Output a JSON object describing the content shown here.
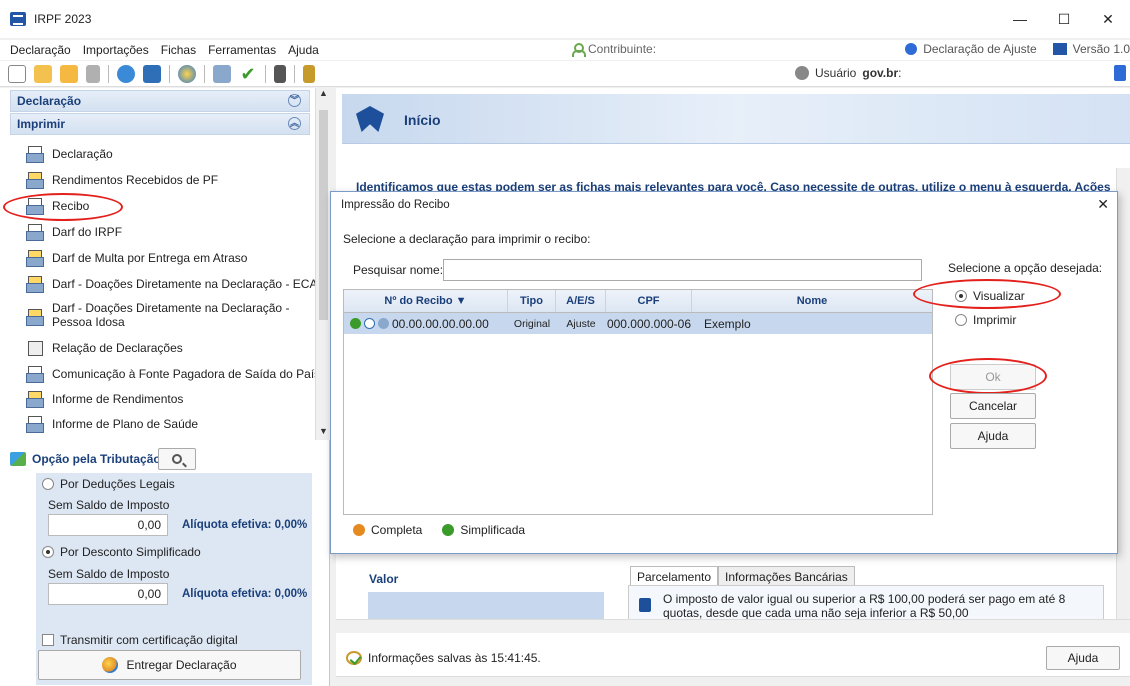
{
  "window": {
    "title": "IRPF 2023"
  },
  "menubar": {
    "items": [
      "Declaração",
      "Importações",
      "Fichas",
      "Ferramentas",
      "Ajuda"
    ],
    "contribuinte": "Contribuinte:",
    "declaracao_ajuste": "Declaração de Ajuste",
    "versao": "Versão 1.0"
  },
  "toolbar": {
    "usuario_prefix": "Usuário",
    "usuario_brand": "gov.br",
    "usuario_suffix": ":"
  },
  "sidebar": {
    "section1": "Declaração",
    "section2": "Imprimir",
    "items": [
      "Declaração",
      "Rendimentos Recebidos de PF",
      "Recibo",
      "Darf do IRPF",
      "Darf de Multa por Entrega em Atraso",
      "Darf - Doações Diretamente na Declaração - ECA",
      "Darf - Doações Diretamente na Declaração -",
      "Pessoa Idosa",
      "Relação de Declarações",
      "Comunicação à Fonte Pagadora de Saída do País",
      "Informe de Rendimentos",
      "Informe de Plano de Saúde"
    ]
  },
  "tributacao": {
    "heading": "Opção pela Tributação:",
    "opt1": "Por Deduções Legais",
    "opt1_sub": "Sem Saldo de Imposto",
    "opt1_value": "0,00",
    "opt1_aliq": "Alíquota efetiva: 0,00%",
    "opt2": "Por Desconto Simplificado",
    "opt2_sub": "Sem Saldo de Imposto",
    "opt2_value": "0,00",
    "opt2_aliq": "Alíquota efetiva: 0,00%",
    "cert": "Transmitir com certificação digital",
    "entregar": "Entregar Declaração"
  },
  "main": {
    "title": "Início",
    "intro": "Identificamos que estas podem ser as fichas mais relevantes para você. Caso necessite de outras, utilize o menu à esquerda.     Ações",
    "valor": "Valor",
    "tab1": "Parcelamento",
    "tab2": "Informações Bancárias",
    "tab_text1": "O imposto de valor igual ou superior a R$ 100,00 poderá ser pago em até 8",
    "tab_text2": "quotas, desde que cada uma não seja inferior a R$ 50,00",
    "saved": "Informações salvas às 15:41:45.",
    "ajuda": "Ajuda"
  },
  "dialog": {
    "title": "Impressão do Recibo",
    "subtitle": "Selecione a declaração para imprimir o recibo:",
    "search_label": "Pesquisar nome:",
    "search_value": "",
    "option_label": "Selecione a opção desejada:",
    "opt_visualizar": "Visualizar",
    "opt_imprimir": "Imprimir",
    "columns": [
      "Nº do Recibo ▼",
      "Tipo",
      "A/E/S",
      "CPF",
      "Nome"
    ],
    "rows": [
      {
        "recibo": "00.00.00.00.00.00",
        "tipo": "Original",
        "aes": "Ajuste",
        "cpf": "000.000.000-06",
        "nome": "Exemplo"
      }
    ],
    "legend_completa": "Completa",
    "legend_simplificada": "Simplificada",
    "btn_ok": "Ok",
    "btn_cancelar": "Cancelar",
    "btn_ajuda": "Ajuda"
  },
  "colors": {
    "accent_blue": "#1a3f7a",
    "highlight_red": "#e3201b",
    "selection": "#c7d8ee"
  }
}
